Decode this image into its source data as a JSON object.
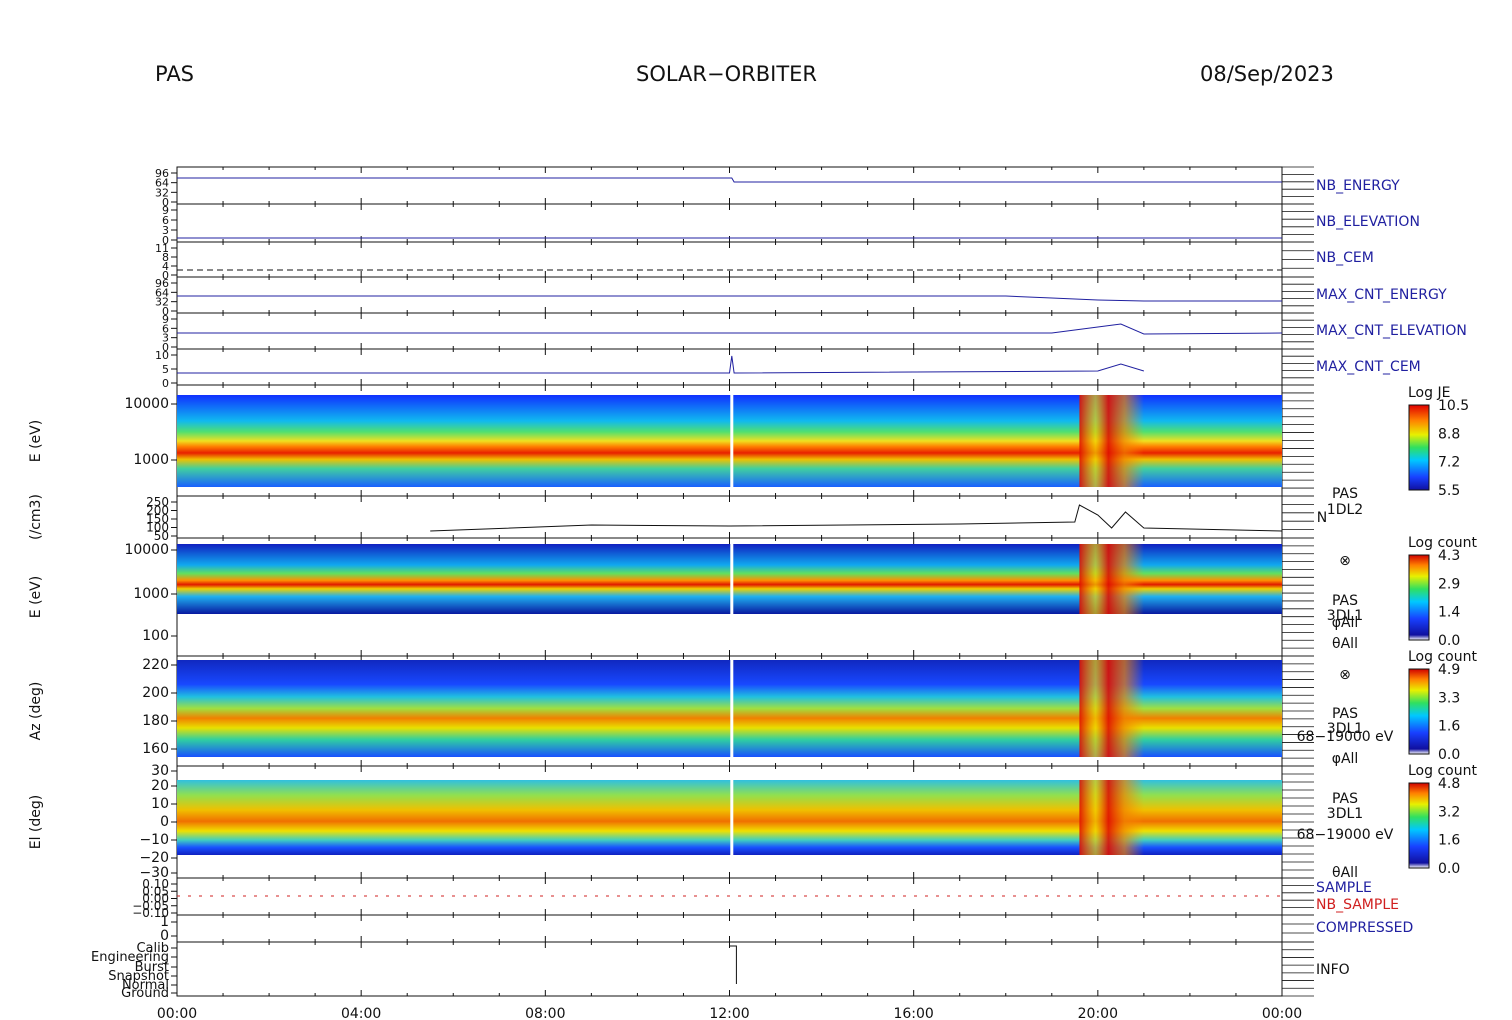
{
  "header": {
    "left": "PAS",
    "center": "SOLAR−ORBITER",
    "right": "08/Sep/2023"
  },
  "chart_data": {
    "type": "multi-panel",
    "x_axis": {
      "range": [
        "00:00",
        "24:00"
      ],
      "ticks": [
        "00:00",
        "04:00",
        "08:00",
        "12:00",
        "16:00",
        "20:00",
        "00:00"
      ]
    },
    "panels": [
      {
        "type": "line",
        "label": "NB_ENERGY",
        "color": "#2020a0",
        "y_ticks": [
          "96",
          "64",
          "32",
          "0"
        ]
      },
      {
        "type": "line",
        "label": "NB_ELEVATION",
        "color": "#2020a0",
        "y_ticks": [
          "9",
          "6",
          "3",
          "0"
        ]
      },
      {
        "type": "line",
        "label": "NB_CEM",
        "color": "#2020a0",
        "y_ticks": [
          "11",
          "8",
          "4",
          "0"
        ]
      },
      {
        "type": "line",
        "label": "MAX_CNT_ENERGY",
        "color": "#2020a0",
        "y_ticks": [
          "96",
          "64",
          "32",
          "0"
        ]
      },
      {
        "type": "line",
        "label": "MAX_CNT_ELEVATION",
        "color": "#2020a0",
        "y_ticks": [
          "9",
          "6",
          "3",
          "0"
        ]
      },
      {
        "type": "line",
        "label": "MAX_CNT_CEM",
        "color": "#2020a0",
        "y_ticks": [
          "10",
          "5",
          "0"
        ]
      },
      {
        "type": "heatmap",
        "ylabel": "E (eV)",
        "y_ticks": [
          "10000",
          "1000"
        ],
        "colorbar": {
          "title": "Log JE",
          "ticks": [
            "10.5",
            "8.8",
            "7.2",
            "5.5"
          ]
        }
      },
      {
        "type": "line",
        "ylabel": "(/cm3)",
        "y_ticks": [
          "250",
          "200",
          "150",
          "100",
          "50"
        ],
        "right_labels": [
          "PAS",
          "1DL2",
          "N"
        ]
      },
      {
        "type": "heatmap",
        "ylabel": "E (eV)",
        "y_ticks": [
          "10000",
          "1000",
          "100"
        ],
        "colorbar": {
          "title": "Log count",
          "ticks": [
            "4.3",
            "2.9",
            "1.4",
            "0.0"
          ]
        },
        "right_labels": [
          "⊗",
          "PAS",
          "3DL1",
          "φAll",
          "θAll"
        ]
      },
      {
        "type": "heatmap",
        "ylabel": "Az (deg)",
        "y_ticks": [
          "220",
          "200",
          "180",
          "160"
        ],
        "colorbar": {
          "title": "Log count",
          "ticks": [
            "4.9",
            "3.3",
            "1.6",
            "0.0"
          ]
        },
        "right_labels": [
          "⊗",
          "PAS",
          "3DL1",
          "68−19000 eV",
          "φAll"
        ]
      },
      {
        "type": "heatmap",
        "ylabel": "El (deg)",
        "y_ticks": [
          "30",
          "20",
          "10",
          "0",
          "−10",
          "−20",
          "−30"
        ],
        "colorbar": {
          "title": "Log count",
          "ticks": [
            "4.8",
            "3.2",
            "1.6",
            "0.0"
          ]
        },
        "right_labels": [
          "PAS",
          "3DL1",
          "68−19000 eV",
          "θAll"
        ]
      },
      {
        "type": "line",
        "labels": [
          "SAMPLE",
          "NB_SAMPLE"
        ],
        "label_colors": [
          "#2020a0",
          "#d02020"
        ],
        "y_ticks": [
          "0.10",
          "0.05",
          "0.00",
          "−0.05",
          "−0.10"
        ]
      },
      {
        "type": "line",
        "label": "COMPRESSED",
        "color": "#2020a0",
        "y_ticks": [
          "1",
          "0"
        ]
      },
      {
        "type": "line",
        "label": "INFO",
        "color": "#111111",
        "y_ticks": [
          "Calib",
          "Engineering",
          "Burst",
          "Snapshot",
          "Normal",
          "Ground"
        ]
      }
    ]
  }
}
